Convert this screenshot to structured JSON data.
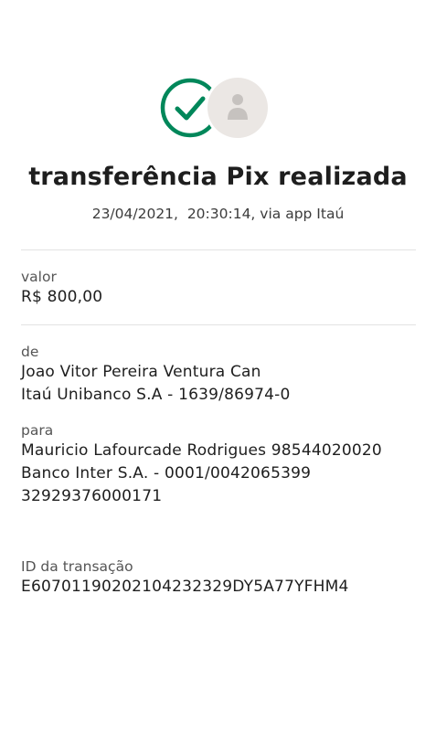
{
  "header": {
    "title": "transferência Pix realizada",
    "subtitle": "23/04/2021,  20:30:14, via app Itaú"
  },
  "icons": {
    "status": "check-circle-icon",
    "recipient": "user-avatar-icon",
    "status_color": "#00875a"
  },
  "valor": {
    "label": "valor",
    "amount": "R$ 800,00"
  },
  "de": {
    "label": "de",
    "name": "Joao Vitor Pereira Ventura Can",
    "bank": "Itaú Unibanco S.A - 1639/86974-0"
  },
  "para": {
    "label": "para",
    "name": "Mauricio Lafourcade Rodrigues 98544020020",
    "bank": "Banco Inter S.A. - 0001/0042065399",
    "document": "32929376000171"
  },
  "transacao": {
    "label": "ID da transação",
    "id": "E60701190202104232329DY5A77YFHM4"
  }
}
